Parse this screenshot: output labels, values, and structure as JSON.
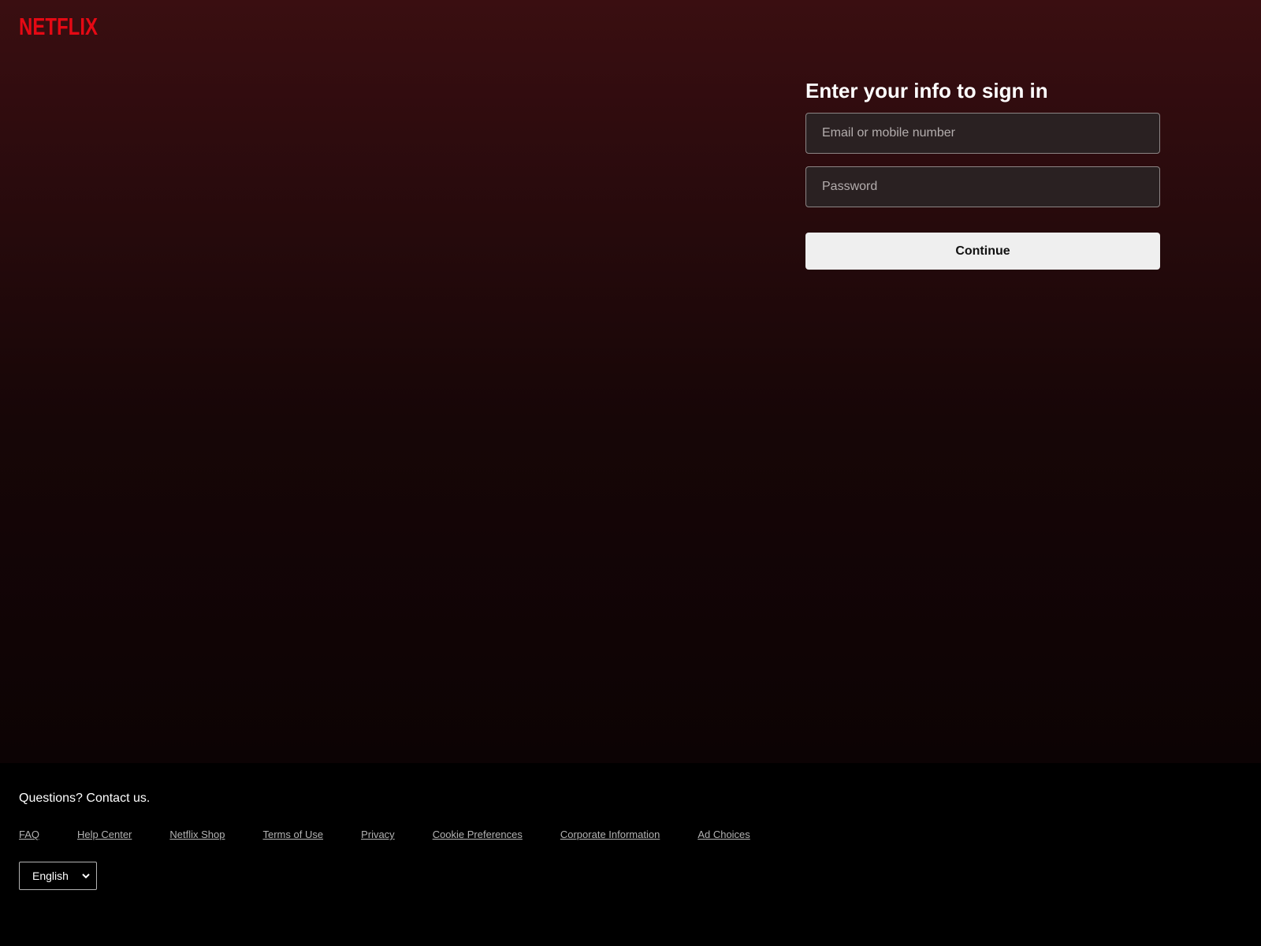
{
  "header": {
    "logo_text": "NETFLIX",
    "brand_color": "#e50914"
  },
  "signin": {
    "title": "Enter your info to sign in",
    "email_placeholder": "Email or mobile number",
    "password_placeholder": "Password",
    "continue_label": "Continue"
  },
  "footer": {
    "contact_text": "Questions? Contact us.",
    "links": [
      "FAQ",
      "Help Center",
      "Netflix Shop",
      "Terms of Use",
      "Privacy",
      "Cookie Preferences",
      "Corporate Information",
      "Ad Choices"
    ],
    "language_selected": "English",
    "language_icon": "chevron-down-icon"
  }
}
